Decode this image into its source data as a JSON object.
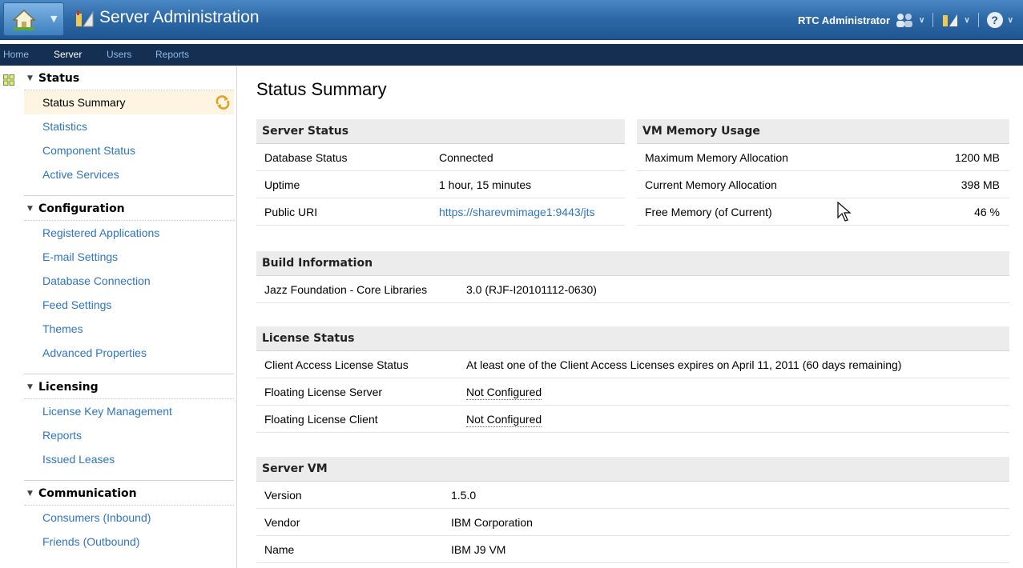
{
  "header": {
    "app_title": "Server Administration",
    "user_name": "RTC Administrator",
    "icons": [
      "home-icon",
      "admin-app-icon",
      "users-group-icon",
      "admin-tools-icon",
      "help-icon"
    ],
    "accent": "#2e6aa7"
  },
  "nav": {
    "home": "Home",
    "server": "Server",
    "users": "Users",
    "reports": "Reports"
  },
  "sidebar": {
    "status": {
      "heading": "Status",
      "items": [
        "Status Summary",
        "Statistics",
        "Component Status",
        "Active Services"
      ]
    },
    "configuration": {
      "heading": "Configuration",
      "items": [
        "Registered Applications",
        "E-mail Settings",
        "Database Connection",
        "Feed Settings",
        "Themes",
        "Advanced Properties"
      ]
    },
    "licensing": {
      "heading": "Licensing",
      "items": [
        "License Key Management",
        "Reports",
        "Issued Leases"
      ]
    },
    "communication": {
      "heading": "Communication",
      "items": [
        "Consumers (Inbound)",
        "Friends (Outbound)"
      ]
    }
  },
  "main": {
    "title": "Status Summary",
    "server_status": {
      "heading": "Server Status",
      "rows": [
        {
          "label": "Database Status",
          "value": "Connected"
        },
        {
          "label": "Uptime",
          "value": "1 hour, 15 minutes"
        },
        {
          "label": "Public URI",
          "value": "https://sharevmimage1:9443/jts"
        }
      ]
    },
    "vm_memory": {
      "heading": "VM Memory Usage",
      "rows": [
        {
          "label": "Maximum Memory Allocation",
          "value": "1200 MB"
        },
        {
          "label": "Current Memory Allocation",
          "value": "398 MB"
        },
        {
          "label": "Free Memory (of Current)",
          "value": "46 %"
        }
      ]
    },
    "build_info": {
      "heading": "Build Information",
      "rows": [
        {
          "label": "Jazz Foundation - Core Libraries",
          "value": "3.0 (RJF-I20101112-0630)"
        }
      ]
    },
    "license_status": {
      "heading": "License Status",
      "rows": [
        {
          "label": "Client Access License Status",
          "value": "At least one of the Client Access Licenses expires on April 11, 2011 (60 days remaining)"
        },
        {
          "label": "Floating License Server",
          "value": "Not Configured"
        },
        {
          "label": "Floating License Client",
          "value": "Not Configured"
        }
      ]
    },
    "server_vm": {
      "heading": "Server VM",
      "rows": [
        {
          "label": "Version",
          "value": "1.5.0"
        },
        {
          "label": "Vendor",
          "value": "IBM Corporation"
        },
        {
          "label": "Name",
          "value": "IBM J9 VM"
        }
      ]
    }
  }
}
